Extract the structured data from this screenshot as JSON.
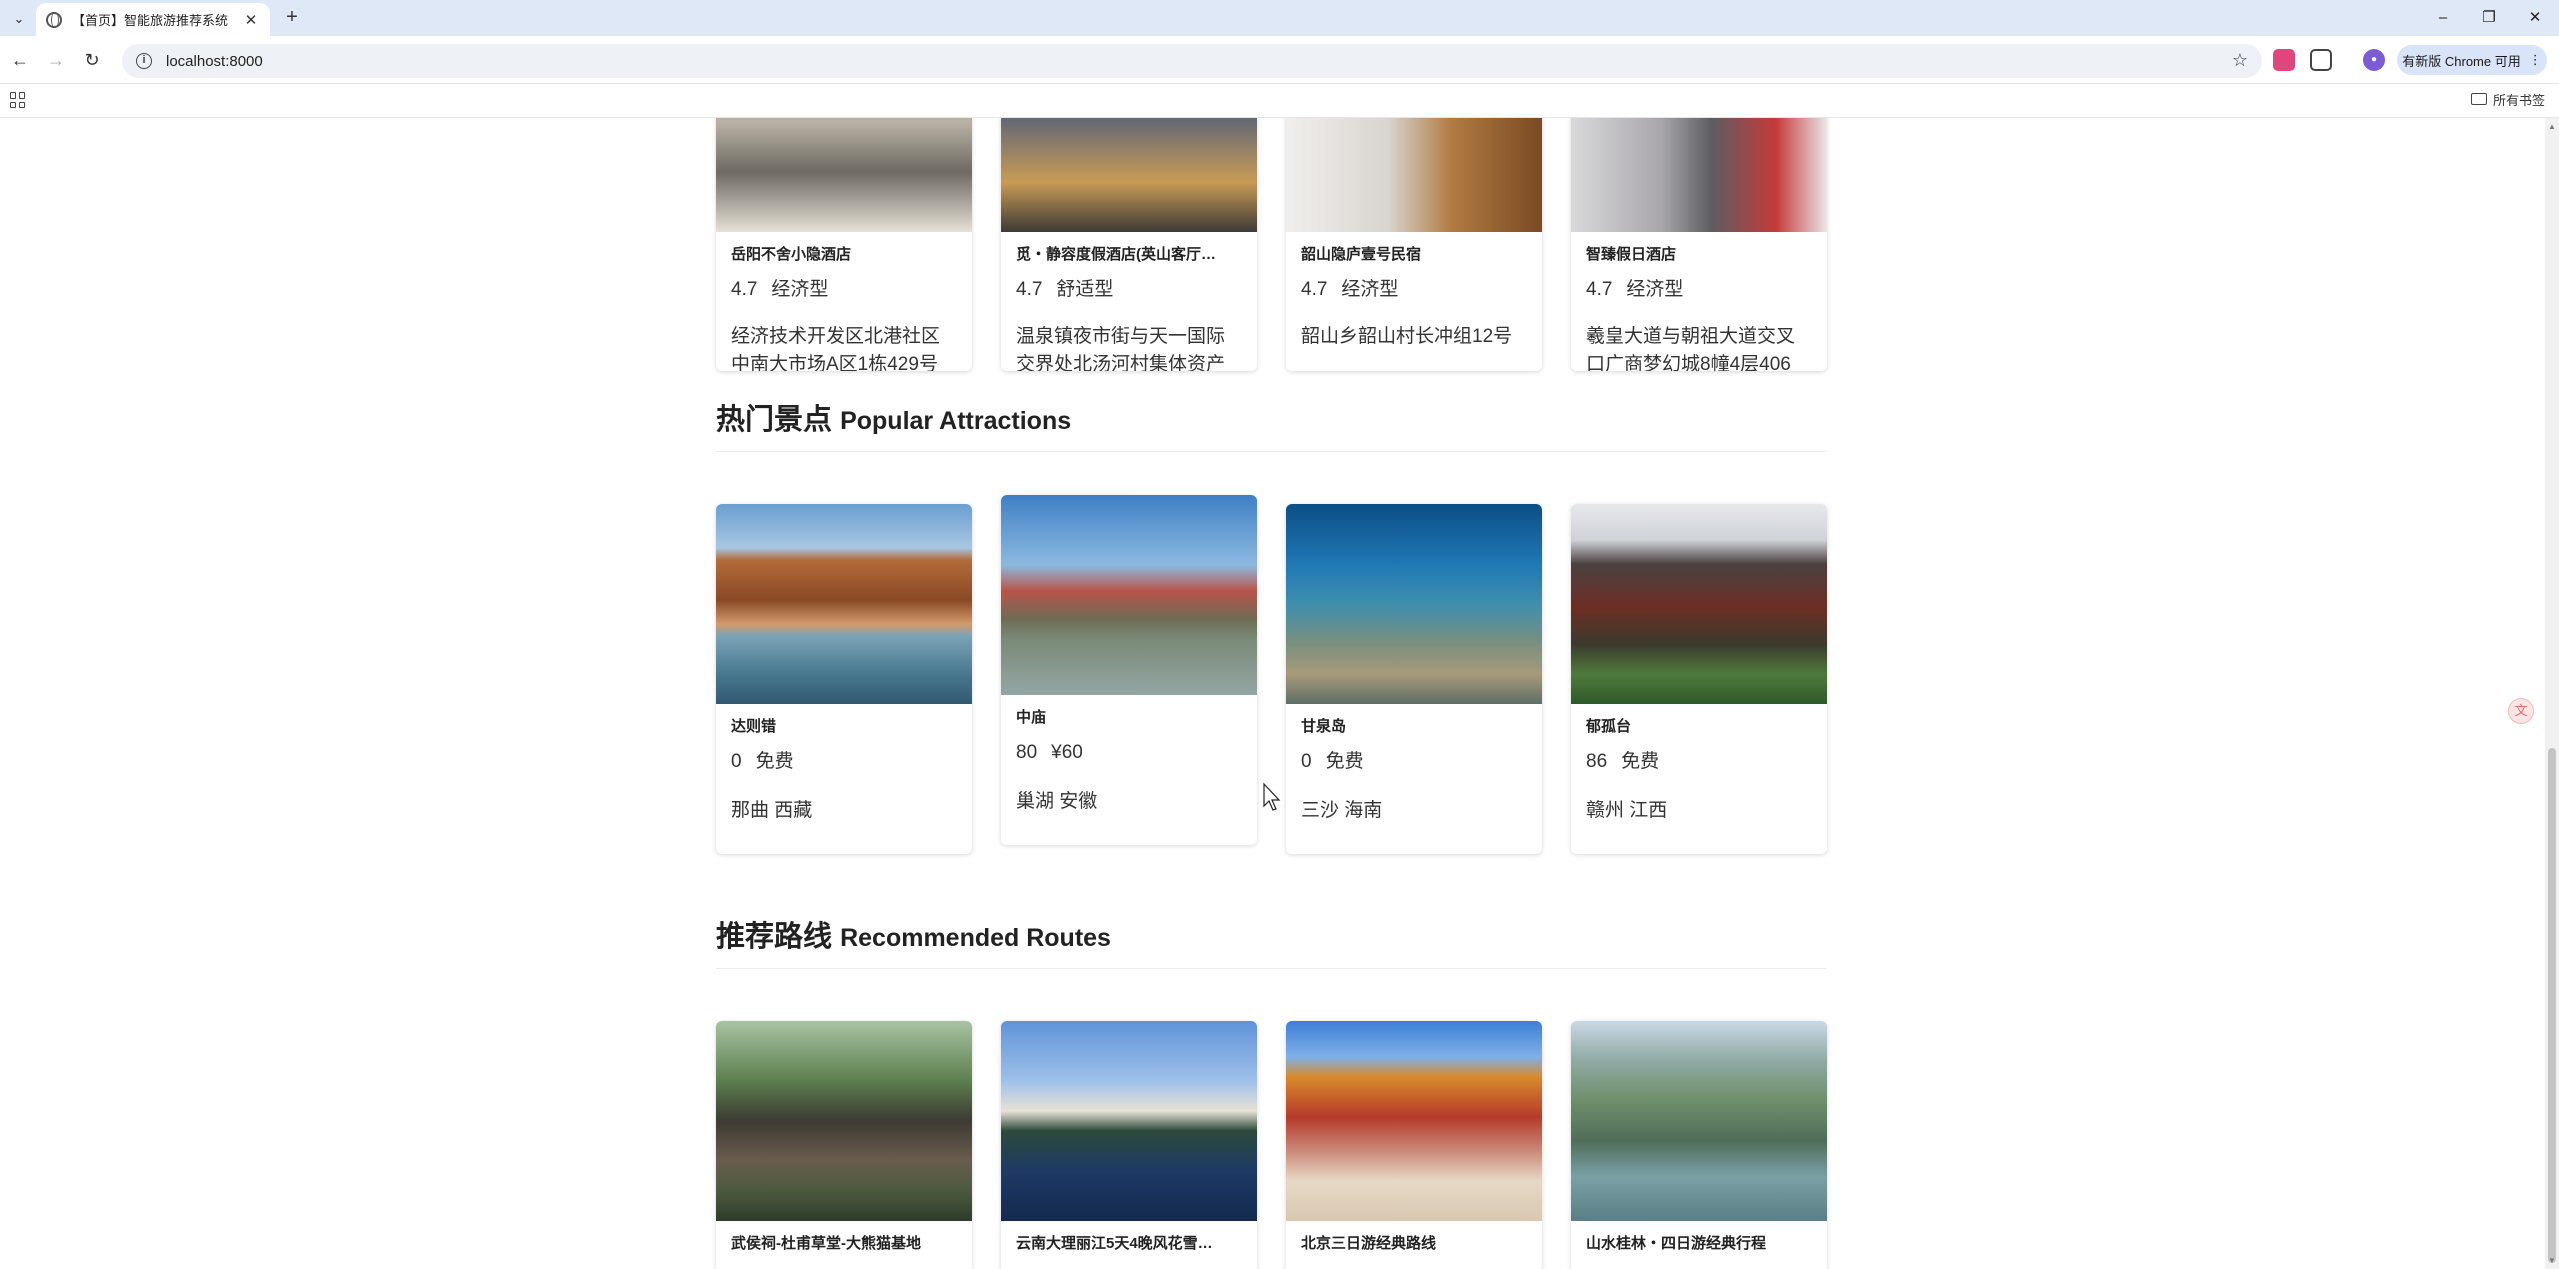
{
  "browser": {
    "tab_title": "【首页】智能旅游推荐系统",
    "url": "localhost:8000",
    "update_label": "有新版 Chrome 可用",
    "bookmarks_label": "所有书签"
  },
  "hotels": [
    {
      "name": "岳阳不舍小隐酒店",
      "rating": "4.7",
      "type": "经济型",
      "address": "经济技术开发区北港社区中南大市场A区1栋429号"
    },
    {
      "name": "觅・静容度假酒店(英山客厅…",
      "rating": "4.7",
      "type": "舒适型",
      "address": "温泉镇夜市街与天一国际交界处北汤河村集体资产"
    },
    {
      "name": "韶山隐庐壹号民宿",
      "rating": "4.7",
      "type": "经济型",
      "address": "韶山乡韶山村长冲组12号"
    },
    {
      "name": "智臻假日酒店",
      "rating": "4.7",
      "type": "经济型",
      "address": "羲皇大道与朝祖大道交叉口广商梦幻城8幢4层406"
    }
  ],
  "attractions_section": {
    "title_cn": "热门景点",
    "title_en": "Popular Attractions"
  },
  "attractions": [
    {
      "name": "达则错",
      "rating": "0",
      "price": "免费",
      "location": "那曲 西藏"
    },
    {
      "name": "中庙",
      "rating": "80",
      "price": "¥60",
      "location": "巢湖 安徽"
    },
    {
      "name": "甘泉岛",
      "rating": "0",
      "price": "免费",
      "location": "三沙 海南"
    },
    {
      "name": "郁孤台",
      "rating": "86",
      "price": "免费",
      "location": "赣州 江西"
    }
  ],
  "routes_section": {
    "title_cn": "推荐路线",
    "title_en": "Recommended Routes"
  },
  "routes": [
    {
      "name": "武侯祠-杜甫草堂-大熊猫基地"
    },
    {
      "name": "云南大理丽江5天4晚风花雪…"
    },
    {
      "name": "北京三日游经典路线"
    },
    {
      "name": "山水桂林・四日游经典行程"
    }
  ]
}
